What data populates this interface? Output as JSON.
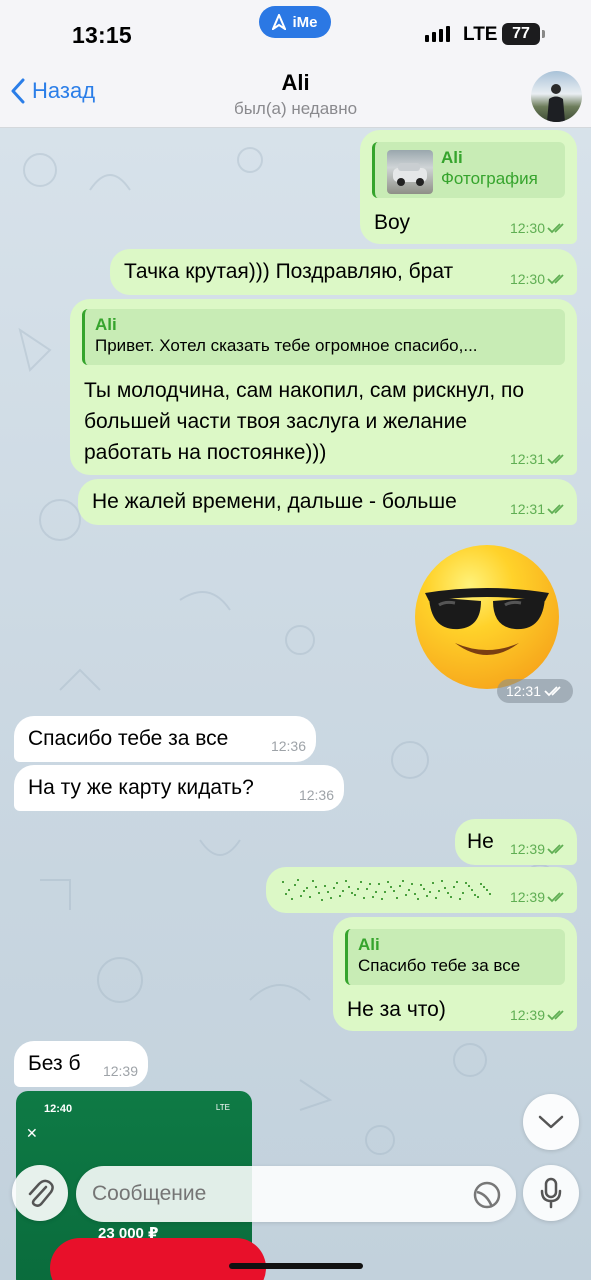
{
  "status": {
    "time": "13:15",
    "network": "LTE",
    "battery": "77",
    "ime_badge": "iMe"
  },
  "header": {
    "back_label": "Назад",
    "title": "Ali",
    "subtitle": "был(а) недавно"
  },
  "messages": [
    {
      "dir": "out",
      "reply_name": "Ali",
      "reply_text": "Фотография",
      "text": "Воу",
      "time": "12:30"
    },
    {
      "dir": "out",
      "text": "Тачка крутая))) Поздравляю, брат",
      "time": "12:30"
    },
    {
      "dir": "out",
      "reply_name": "Ali",
      "reply_text": "Привет. Хотел сказать тебе огромное спасибо,...",
      "text": "Ты молодчина, сам накопил, сам рискнул, по большей части твоя заслуга и желание работать на постоянке)))",
      "time": "12:31"
    },
    {
      "dir": "out",
      "text": "Не жалей времени, дальше - больше",
      "time": "12:31"
    },
    {
      "dir": "out",
      "emoji": "smiling-face-with-sunglasses",
      "time": "12:31"
    },
    {
      "dir": "in",
      "text": "Спасибо тебе за все",
      "time": "12:36"
    },
    {
      "dir": "in",
      "text": "На ту же карту кидать?",
      "time": "12:36"
    },
    {
      "dir": "out",
      "text": "Не",
      "time": "12:39"
    },
    {
      "dir": "out",
      "hidden_spoiler": true,
      "time": "12:39"
    },
    {
      "dir": "out",
      "reply_name": "Ali",
      "reply_text": "Спасибо тебе за все",
      "text": "Не за что)",
      "time": "12:39"
    },
    {
      "dir": "in",
      "text": "Без б",
      "time": "12:39"
    },
    {
      "dir": "in",
      "image": {
        "time": "12:40",
        "lte": "LTE",
        "amount": "23 000 ₽"
      }
    }
  ],
  "composer": {
    "placeholder": "Сообщение"
  },
  "colors": {
    "outgoing": "#dcf8c6",
    "incoming": "#ffffff",
    "accent": "#2b7ee8",
    "check": "#5fae53"
  }
}
